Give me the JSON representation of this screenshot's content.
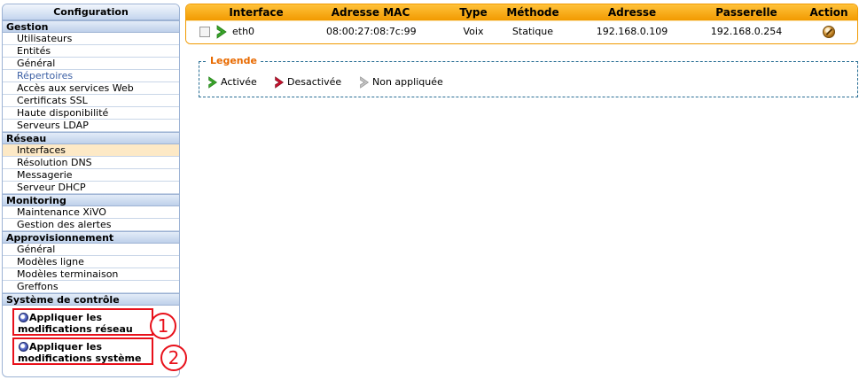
{
  "colors": {
    "accent": "#f29a00",
    "active_arrow": "#3aa52a",
    "disabled_arrow": "#c8102e",
    "not_applied_arrow": "#9a9a9a",
    "highlight_red": "#e8101a",
    "sidebar_border": "#9db3d4"
  },
  "sidebar": {
    "title": "Configuration",
    "sections": [
      {
        "label": "Gestion",
        "items": [
          "Utilisateurs",
          "Entités",
          "Général",
          "Répertoires",
          "Accès aux services Web",
          "Certificats SSL",
          "Haute disponibilité",
          "Serveurs LDAP"
        ]
      },
      {
        "label": "Réseau",
        "items": [
          "Interfaces",
          "Résolution DNS",
          "Messagerie",
          "Serveur DHCP"
        ]
      },
      {
        "label": "Monitoring",
        "items": [
          "Maintenance XiVO",
          "Gestion des alertes"
        ]
      },
      {
        "label": "Approvisionnement",
        "items": [
          "Général",
          "Modèles ligne",
          "Modèles terminaison",
          "Greffons"
        ]
      },
      {
        "label": "Système de contrôle",
        "items": []
      }
    ],
    "selected_item": "Interfaces",
    "link_item": "Répertoires",
    "system_control": [
      {
        "line1": "Appliquer les",
        "line2": "modifications réseau",
        "icon": "gear-icon",
        "marker": "1"
      },
      {
        "line1": "Appliquer les",
        "line2": "modifications système",
        "icon": "gear-icon",
        "marker": "2"
      }
    ]
  },
  "table": {
    "columns": [
      "Interface",
      "Adresse MAC",
      "Type",
      "Méthode",
      "Adresse",
      "Passerelle",
      "Action"
    ],
    "rows": [
      {
        "interface": "eth0",
        "mac": "08:00:27:08:7c:99",
        "type": "Voix",
        "method": "Statique",
        "address": "192.168.0.109",
        "gateway": "192.168.0.254",
        "status_icon": "active-arrow-icon",
        "action_icon": "edit-icon"
      }
    ]
  },
  "legend": {
    "title": "Legende",
    "items": [
      {
        "label": "Activée",
        "icon": "active-arrow-icon"
      },
      {
        "label": "Desactivée",
        "icon": "disabled-arrow-icon"
      },
      {
        "label": "Non appliquée",
        "icon": "not-applied-arrow-icon"
      }
    ]
  }
}
